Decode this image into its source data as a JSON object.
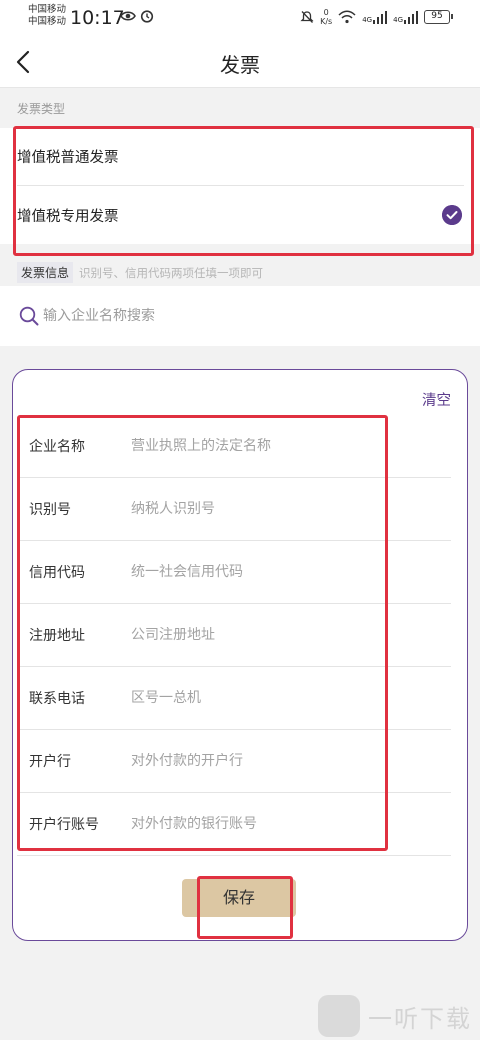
{
  "status_bar": {
    "carrier_1": "中国移动",
    "carrier_2": "中国移动",
    "time": "10:17",
    "net_speed_value": "0",
    "net_speed_unit": "K/s",
    "signal_1": "4G",
    "signal_2": "4G",
    "battery": "95"
  },
  "header": {
    "title": "发票"
  },
  "invoice_type": {
    "label": "发票类型",
    "options": [
      {
        "label": "增值税普通发票",
        "selected": false
      },
      {
        "label": "增值税专用发票",
        "selected": true
      }
    ]
  },
  "invoice_info": {
    "tag": "发票信息",
    "hint": "识别号、信用代码两项任填一项即可"
  },
  "search": {
    "placeholder": "输入企业名称搜索"
  },
  "form": {
    "clear_label": "清空",
    "fields": [
      {
        "label": "企业名称",
        "placeholder": "营业执照上的法定名称",
        "value": ""
      },
      {
        "label": "识别号",
        "placeholder": "纳税人识别号",
        "value": ""
      },
      {
        "label": "信用代码",
        "placeholder": "统一社会信用代码",
        "value": ""
      },
      {
        "label": "注册地址",
        "placeholder": "公司注册地址",
        "value": ""
      },
      {
        "label": "联系电话",
        "placeholder": "区号一总机",
        "value": ""
      },
      {
        "label": "开户行",
        "placeholder": "对外付款的开户行",
        "value": ""
      },
      {
        "label": "开户行账号",
        "placeholder": "对外付款的银行账号",
        "value": ""
      }
    ],
    "save_label": "保存"
  },
  "watermark": {
    "text": "一听下载"
  },
  "colors": {
    "accent": "#5b3b8c",
    "highlight_box": "#e03140",
    "save_button": "#dcc7a3"
  }
}
